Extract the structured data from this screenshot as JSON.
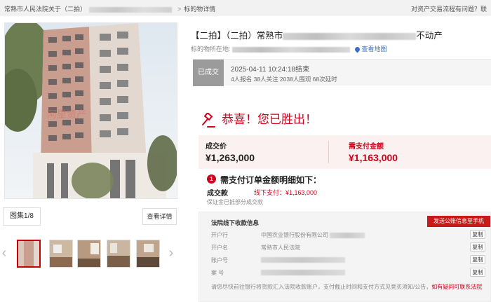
{
  "breadcrumb": {
    "prefix": "常熟市人民法院关于（二拍）",
    "separator": ">",
    "current": "标的物详情"
  },
  "help_link": "对资产交易流程有问题？联",
  "gallery": {
    "count_label": "图集1/8",
    "detail_button": "查看详情",
    "prev_arrow": "‹",
    "next_arrow": "›",
    "thumbnails": 5,
    "selected_index": 0
  },
  "listing": {
    "title_prefix": "【二拍】（二拍）常熟市",
    "title_suffix": "不动产",
    "address_label": "标的物所在地:",
    "map_link": "查看地图"
  },
  "status": {
    "badge": "已成交",
    "end_time": "2025-04-11 10:24:18结束",
    "stats": "4人报名  38人关注  2038人围观  68次延时"
  },
  "result": {
    "congrats": "恭喜！您已胜出！"
  },
  "price": {
    "deal_label": "成交价",
    "deal_value": "¥1,263,000",
    "pay_label": "需支付金额",
    "pay_value": "¥1,163,000"
  },
  "order_detail": {
    "step_number": "1",
    "heading": "需支付订单金额明细如下：",
    "deal_amount_label": "成交款",
    "offline_payment": "线下支付：¥1,163,000",
    "deposit_note": "保证金已抵部分成交款"
  },
  "bank_info": {
    "title": "法院线下收款信息",
    "send_button": "发送公账信息至手机",
    "rows": [
      {
        "label": "开户行",
        "value": "中国农业银行股份有限公司",
        "copy": "复制"
      },
      {
        "label": "开户名",
        "value": "常熟市人民法院",
        "copy": "复制"
      },
      {
        "label": "账户号",
        "value": "",
        "copy": "复制"
      },
      {
        "label": "案  号",
        "value": "",
        "copy": "复制"
      }
    ],
    "notice_text": "请您尽快前往银行将货款汇入法院收款账户，支付截止时间和支付方式见竞买须知/公告，",
    "notice_link": "如有疑问可联系法院"
  },
  "colors": {
    "accent_red": "#d0021b",
    "price_box_bg": "#fbf1f1",
    "status_badge_bg": "#9b9b9b"
  }
}
